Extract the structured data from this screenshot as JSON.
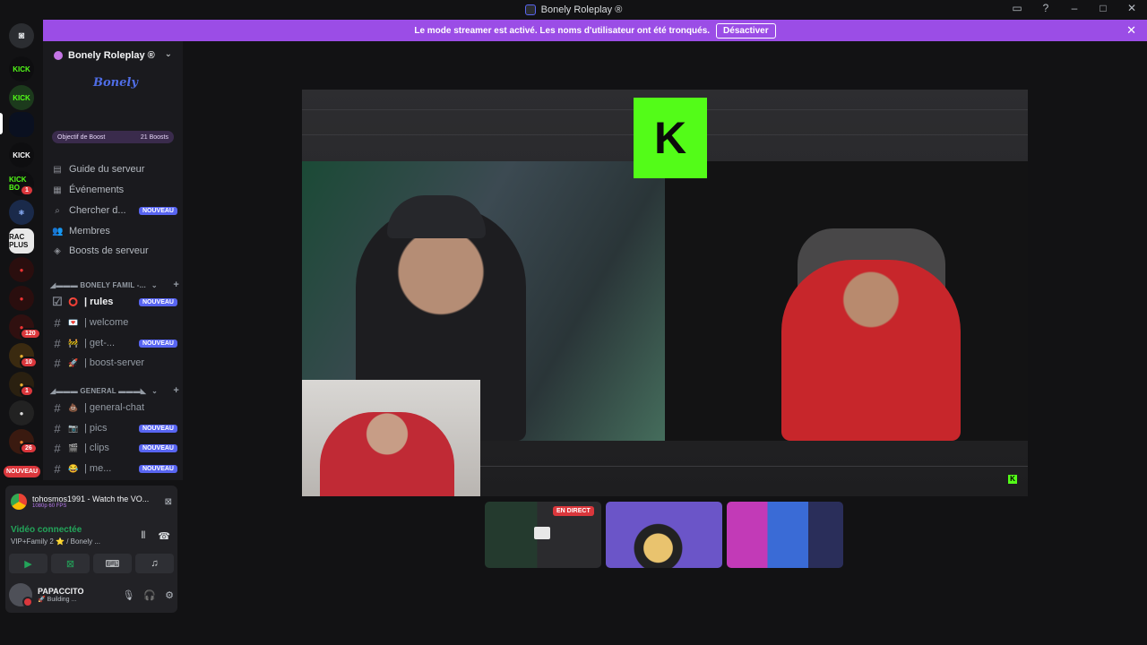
{
  "window": {
    "title": "Bonely Roleplay ®"
  },
  "banner": {
    "message": "Le mode streamer est activé. Les noms d'utilisateur ont été tronqués.",
    "button": "Désactiver"
  },
  "rail": {
    "servers": [
      "KICK",
      "KICK",
      "",
      "KICK",
      "KICK BO",
      "",
      "RAC PLUS",
      "",
      "",
      "",
      "",
      "",
      "",
      ""
    ],
    "badges": [
      "1",
      "120",
      "10",
      "1",
      "26"
    ],
    "new_label": "NOUVEAU"
  },
  "sidebar": {
    "server_name": "Bonely Roleplay ®",
    "logo_text": "Bonely",
    "boost_goal": "Objectif de Boost",
    "boost_count": "21 Boosts",
    "menu": [
      {
        "label": "Guide du serveur",
        "icon": "guide-icon"
      },
      {
        "label": "Événements",
        "icon": "calendar-icon"
      },
      {
        "label": "Chercher d...",
        "icon": "search-channels-icon",
        "tag": "NOUVEAU"
      },
      {
        "label": "Membres",
        "icon": "members-icon"
      },
      {
        "label": "Boosts de serveur",
        "icon": "boost-icon"
      }
    ],
    "categories": [
      {
        "label": "◢▬▬▬ BONELY FAMIL -...",
        "channels": [
          {
            "label": "| rules",
            "emoji": "⭕",
            "tag": "NOUVEAU",
            "active": true
          },
          {
            "label": "| welcome",
            "emoji": "💌"
          },
          {
            "label": "| get-...",
            "emoji": "🚧",
            "tag": "NOUVEAU"
          },
          {
            "label": "| boost-server",
            "emoji": "🚀"
          }
        ]
      },
      {
        "label": "◢▬▬▬ GENERAL ▬▬▬◣",
        "channels": [
          {
            "label": "| general-chat",
            "emoji": "💩"
          },
          {
            "label": "| pics",
            "emoji": "📷",
            "tag": "NOUVEAU"
          },
          {
            "label": "| clips",
            "emoji": "🎬",
            "tag": "NOUVEAU"
          },
          {
            "label": "| me...",
            "emoji": "😂",
            "tag": "NOUVEAU"
          }
        ]
      }
    ]
  },
  "voice": {
    "stream_user": "tohosmos1991 - Watch the VO...",
    "stream_quality": "1080p 60 FPS",
    "status": "Vidéo connectée",
    "channel": "VIP+Family 2 ⭐ / Bonely ...",
    "username": "PAPACCITO",
    "user_status": "🚀 Building ..."
  },
  "stage": {
    "live_label": "EN DIRECT"
  }
}
